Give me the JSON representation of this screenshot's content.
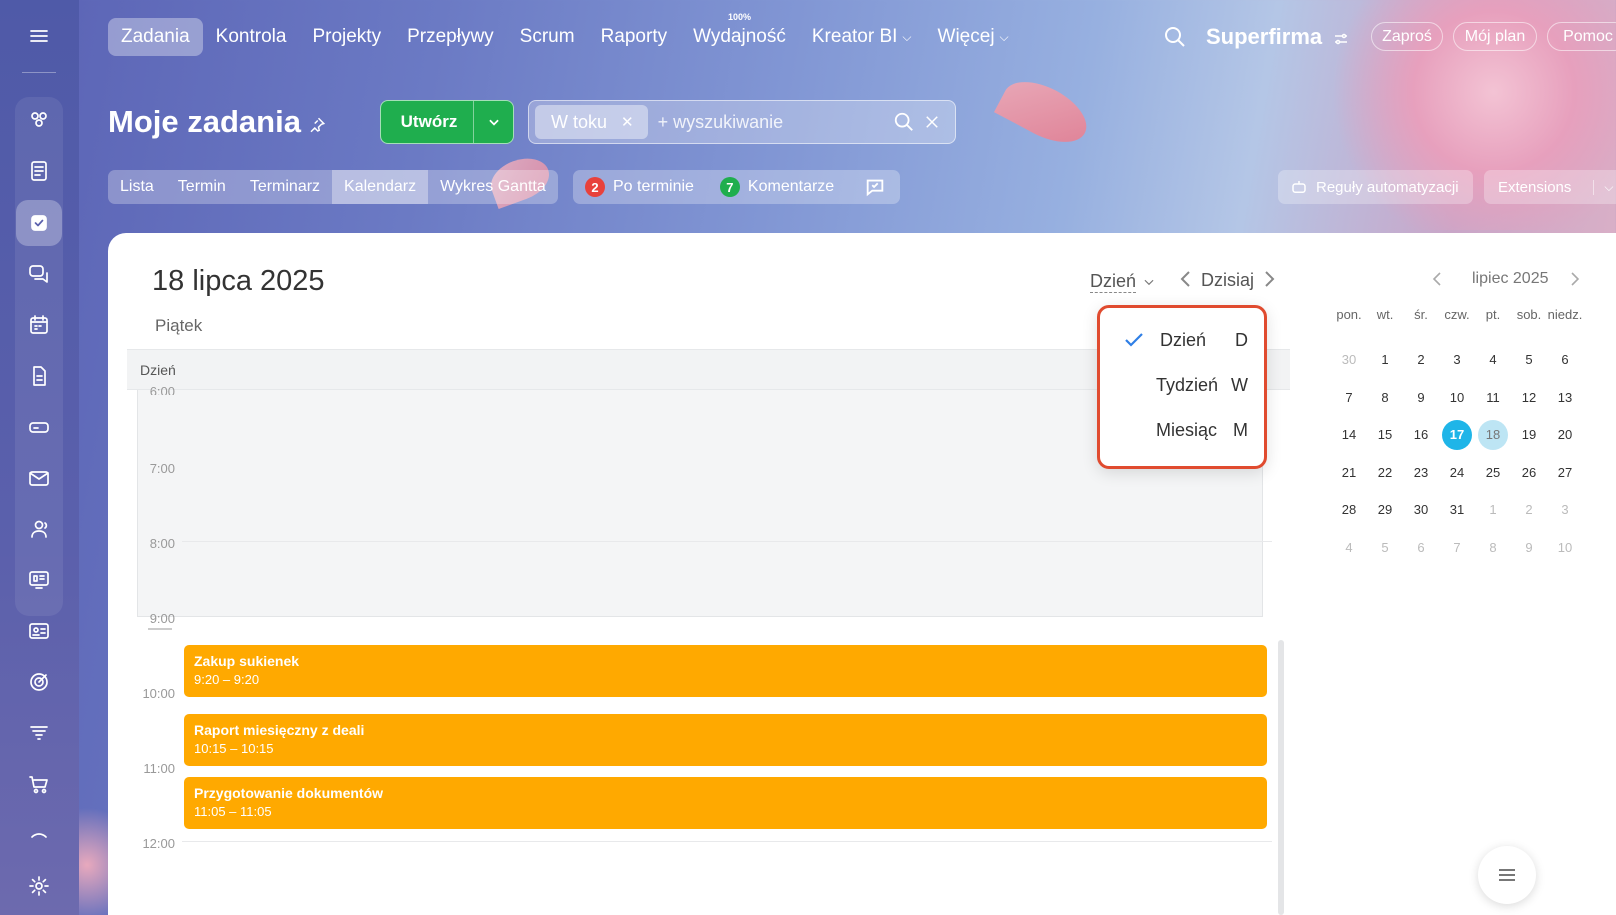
{
  "topnav": {
    "items": [
      {
        "label": "Zadania",
        "active": true
      },
      {
        "label": "Kontrola"
      },
      {
        "label": "Projekty"
      },
      {
        "label": "Przepływy"
      },
      {
        "label": "Scrum"
      },
      {
        "label": "Raporty"
      },
      {
        "label": "Wydajność",
        "sup": "100%"
      },
      {
        "label": "Kreator BI",
        "dropdown": true
      },
      {
        "label": "Więcej",
        "dropdown": true
      }
    ],
    "company": "Superfirma",
    "invite": "Zaproś",
    "plan": "Mój plan",
    "help": "Pomoc"
  },
  "page": {
    "title": "Moje zadania",
    "create_label": "Utwórz"
  },
  "search": {
    "chip": "W toku",
    "placeholder": "+ wyszukiwanie"
  },
  "viewtabs": [
    "Lista",
    "Termin",
    "Terminarz",
    "Kalendarz",
    "Wykres Gantta"
  ],
  "active_view": "Kalendarz",
  "counters": {
    "overdue": {
      "count": "2",
      "label": "Po terminie",
      "color": "#e8413c"
    },
    "comments": {
      "count": "7",
      "label": "Komentarze",
      "color": "#1fae4e"
    }
  },
  "automation_label": "Reguły automatyzacji",
  "extensions_label": "Extensions",
  "calendar": {
    "date": "18 lipca 2025",
    "weekday": "Piątek",
    "day_header": "Dzień",
    "view_selector": "Dzień",
    "today_label": "Dzisiaj",
    "hours": [
      "6:00",
      "7:00",
      "8:00",
      "9:00",
      "10:00",
      "11:00",
      "12:00"
    ],
    "events": [
      {
        "title": "Zakup sukienek",
        "time": "9:20 – 9:20"
      },
      {
        "title": "Raport miesięczny z deali",
        "time": "10:15 – 10:15"
      },
      {
        "title": "Przygotowanie dokumentów",
        "time": "11:05 – 11:05"
      }
    ]
  },
  "view_menu": [
    {
      "label": "Dzień",
      "key": "D",
      "checked": true
    },
    {
      "label": "Tydzień",
      "key": "W"
    },
    {
      "label": "Miesiąc",
      "key": "M"
    }
  ],
  "mini_calendar": {
    "title": "lipiec 2025",
    "weekdays": [
      "pon.",
      "wt.",
      "śr.",
      "czw.",
      "pt.",
      "sob.",
      "niedz."
    ],
    "weeks": [
      [
        "30",
        "1",
        "2",
        "3",
        "4",
        "5",
        "6"
      ],
      [
        "7",
        "8",
        "9",
        "10",
        "11",
        "12",
        "13"
      ],
      [
        "14",
        "15",
        "16",
        "17",
        "18",
        "19",
        "20"
      ],
      [
        "21",
        "22",
        "23",
        "24",
        "25",
        "26",
        "27"
      ],
      [
        "28",
        "29",
        "30",
        "31",
        "1",
        "2",
        "3"
      ],
      [
        "4",
        "5",
        "6",
        "7",
        "8",
        "9",
        "10"
      ]
    ],
    "today": "17",
    "selected": "18"
  },
  "colors": {
    "accent": "#1fae4e",
    "event": "#ffa900",
    "today": "#1fb5e8",
    "highlight": "#e04b2f"
  }
}
